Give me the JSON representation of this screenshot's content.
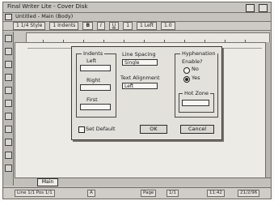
{
  "window": {
    "title": "Final Writer Lite - Cover Disk"
  },
  "document": {
    "title": "Untitled - Main (Body)"
  },
  "ribbon": {
    "buttons": [
      "1 1/4 Style",
      "1 Indents",
      "B",
      "I",
      "U",
      "1",
      "1 Left",
      "1.0"
    ]
  },
  "dialog": {
    "indents": {
      "label": "Indents",
      "left_label": "Left",
      "right_label": "Right",
      "first_label": "First",
      "left_value": "",
      "right_value": "",
      "first_value": ""
    },
    "line_spacing": {
      "label": "Line Spacing",
      "value": "Single"
    },
    "text_alignment": {
      "label": "Text Alignment",
      "value": "Left"
    },
    "hyphenation": {
      "label": "Hyphenation",
      "enable_label": "Enable?",
      "no_label": "No",
      "yes_label": "Yes",
      "selected": "Yes",
      "hot_zone_label": "Hot Zone",
      "hot_zone_value": ""
    },
    "set_default_label": "Set Default",
    "ok_label": "OK",
    "cancel_label": "Cancel"
  },
  "tab": {
    "main": "Main"
  },
  "status": {
    "items": [
      "Line 1/1  Pos 1/1",
      "A",
      "Page",
      "1/1",
      "11:42",
      "21/2/96"
    ]
  }
}
